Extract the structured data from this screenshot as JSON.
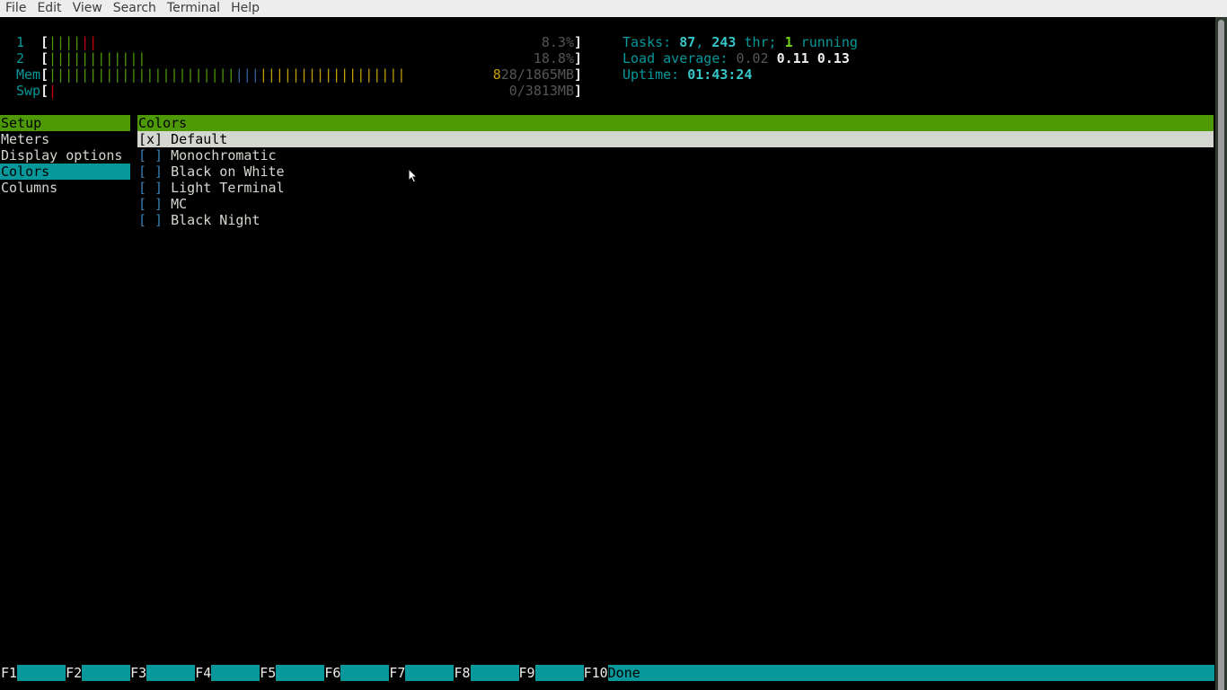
{
  "menubar": [
    "File",
    "Edit",
    "View",
    "Search",
    "Terminal",
    "Help"
  ],
  "meters": {
    "cpu1": {
      "label": "1",
      "green": 4,
      "red": 2,
      "value": "8.3%"
    },
    "cpu2": {
      "label": "2",
      "green": 12,
      "red": 0,
      "value": "18.8%"
    },
    "mem": {
      "label": "Mem",
      "green": 23,
      "blue": 3,
      "yellow": 18,
      "value": "828/1865MB"
    },
    "swp": {
      "label": "Swp",
      "red": 1,
      "value": "0/3813MB"
    }
  },
  "stats": {
    "tasks_label": "Tasks: ",
    "tasks": "87",
    "sep": ", ",
    "threads": "243",
    "thr_label": " thr; ",
    "running": "1",
    "running_label": " running",
    "load_label": "Load average: ",
    "load1": "0.02",
    "load5": "0.11",
    "load15": "0.13",
    "uptime_label": "Uptime: ",
    "uptime": "01:43:24"
  },
  "setup": {
    "header": "Setup",
    "items": [
      "Meters",
      "Display options",
      "Colors",
      "Columns"
    ],
    "selected": "Colors"
  },
  "colors": {
    "header": "Colors",
    "items": [
      {
        "check": "[x]",
        "label": "Default",
        "selected": true
      },
      {
        "check": "[ ]",
        "label": "Monochromatic"
      },
      {
        "check": "[ ]",
        "label": "Black on White"
      },
      {
        "check": "[ ]",
        "label": "Light Terminal"
      },
      {
        "check": "[ ]",
        "label": "MC"
      },
      {
        "check": "[ ]",
        "label": "Black Night"
      }
    ]
  },
  "footer": [
    {
      "key": "F1",
      "label": ""
    },
    {
      "key": "F2",
      "label": ""
    },
    {
      "key": "F3",
      "label": ""
    },
    {
      "key": "F4",
      "label": ""
    },
    {
      "key": "F5",
      "label": ""
    },
    {
      "key": "F6",
      "label": ""
    },
    {
      "key": "F7",
      "label": ""
    },
    {
      "key": "F8",
      "label": ""
    },
    {
      "key": "F9",
      "label": ""
    },
    {
      "key": "F10",
      "label": "Done"
    }
  ]
}
